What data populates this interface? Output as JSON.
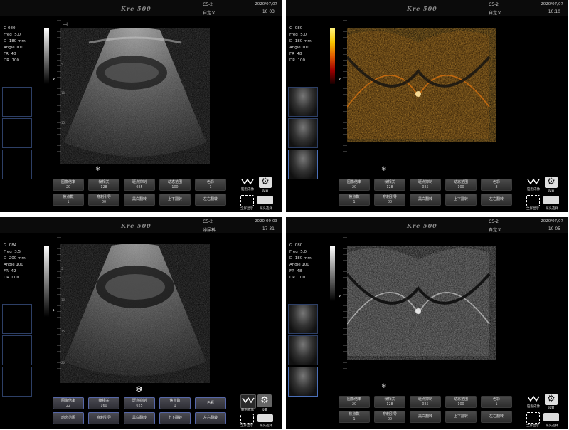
{
  "panels": [
    {
      "logo": "Kre 500",
      "probe": "C5-2",
      "preset": "自定义",
      "date": "2020/07/07",
      "time": "10 03",
      "params": [
        "G 080",
        "Freq  5,0",
        "D  180 mm",
        "Angle 100",
        "FR  48",
        "DR  100"
      ],
      "colorbar": "greyscale",
      "depth_labels": [
        "5",
        "10",
        "15"
      ],
      "controls": [
        {
          "label": "图像倍率",
          "value": "20"
        },
        {
          "label": "帧相关",
          "value": "128"
        },
        {
          "label": "斑点抑制",
          "value": "025"
        },
        {
          "label": "动态范围",
          "value": "100"
        },
        {
          "label": "色彩",
          "value": "1"
        },
        {
          "label": "焦点数",
          "value": "1"
        },
        {
          "label": "穿刺引导",
          "value": "00"
        },
        {
          "label": "黑白翻转",
          "value": ""
        },
        {
          "label": "上下翻转",
          "value": ""
        },
        {
          "label": "左右翻转",
          "value": ""
        }
      ],
      "icon_labels": [
        "脑泡成像",
        "设置",
        "全屏显示",
        "探头选择"
      ]
    },
    {
      "logo": "Kre 500",
      "probe": "C5-2",
      "preset": "自定义",
      "date": "2020/07/07",
      "time": "10:10",
      "params": [
        "G  080",
        "Freq  5,0",
        "D  180 mm",
        "Angle 100",
        "FR  48",
        "DR  100"
      ],
      "colorbar": "heat",
      "depth_labels": [
        "5",
        "10",
        "15"
      ],
      "controls": [
        {
          "label": "图像倍率",
          "value": "20"
        },
        {
          "label": "帧相关",
          "value": "128"
        },
        {
          "label": "斑点抑制",
          "value": "025"
        },
        {
          "label": "动态范围",
          "value": "100"
        },
        {
          "label": "色彩",
          "value": "8"
        },
        {
          "label": "焦点数",
          "value": "1"
        },
        {
          "label": "穿刺引导",
          "value": "00"
        },
        {
          "label": "黑白翻转",
          "value": ""
        },
        {
          "label": "上下翻转",
          "value": ""
        },
        {
          "label": "左右翻转",
          "value": ""
        }
      ],
      "icon_labels": [
        "脑泡成像",
        "设置",
        "全屏显示",
        "探头选择"
      ]
    },
    {
      "logo": "Kre 500",
      "probe": "C5-2",
      "preset": "泌尿科",
      "date": "2020-09-03",
      "time": "17 31",
      "params": [
        "G  084",
        "Freq  3,5",
        "D  200 mm",
        "Angle 100",
        "FR  42",
        "DR  000"
      ],
      "colorbar": "greyscale",
      "depth_labels": [
        "5",
        "10",
        "15",
        "20"
      ],
      "controls": [
        {
          "label": "图像倍率",
          "value": "22"
        },
        {
          "label": "帧相关",
          "value": "160"
        },
        {
          "label": "斑点抑制",
          "value": "025"
        },
        {
          "label": "焦点数",
          "value": "1"
        },
        {
          "label": "色彩",
          "value": ""
        },
        {
          "label": "动态范围",
          "value": ""
        },
        {
          "label": "穿刺引导",
          "value": ""
        },
        {
          "label": "黑白翻转",
          "value": ""
        },
        {
          "label": "上下翻转",
          "value": ""
        },
        {
          "label": "左右翻转",
          "value": ""
        }
      ],
      "icon_labels": [
        "脑泡成像",
        "设置",
        "全屏显示",
        "探头选择"
      ]
    },
    {
      "logo": "Kre 500",
      "probe": "C5-2",
      "preset": "自定义",
      "date": "2020/07/07",
      "time": "10 05",
      "params": [
        "G  080",
        "Freq  5,0",
        "D  180 mm",
        "Angle 100",
        "FR  48",
        "DR  100"
      ],
      "colorbar": "greyscale",
      "depth_labels": [
        "5",
        "10",
        "15"
      ],
      "controls": [
        {
          "label": "图像倍率",
          "value": "20"
        },
        {
          "label": "帧相关",
          "value": "128"
        },
        {
          "label": "斑点抑制",
          "value": "025"
        },
        {
          "label": "动态范围",
          "value": "100"
        },
        {
          "label": "色彩",
          "value": "1"
        },
        {
          "label": "焦点数",
          "value": "1"
        },
        {
          "label": "穿刺引导",
          "value": "00"
        },
        {
          "label": "黑白翻转",
          "value": ""
        },
        {
          "label": "上下翻转",
          "value": ""
        },
        {
          "label": "左右翻转",
          "value": ""
        }
      ],
      "icon_labels": [
        "脑泡成像",
        "设置",
        "全屏显示",
        "探头选择"
      ]
    }
  ],
  "colors": {
    "panel_bg": "#000000",
    "button_blue_border": "#5667a8",
    "heat_top": "#fff27a",
    "heat_mid": "#e05a00"
  },
  "icons": [
    "freeze-wave-icon",
    "gear-icon",
    "fullscreen-icon",
    "probe-select-icon",
    "snowflake-icon"
  ]
}
